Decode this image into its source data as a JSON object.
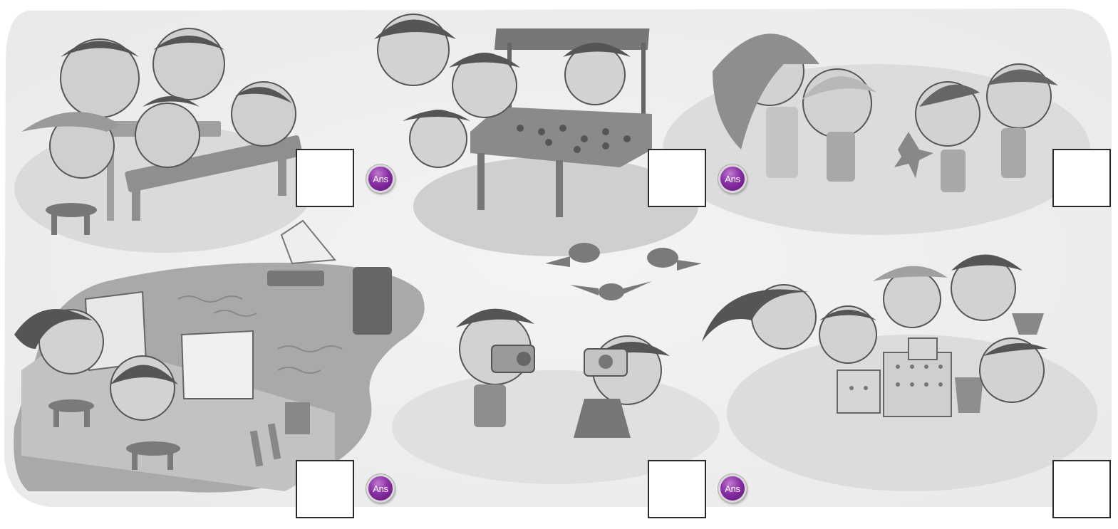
{
  "scenes": [
    {
      "name": "scene-picnic-table",
      "description_icon": "children-eating-at-bench-icon"
    },
    {
      "name": "scene-shell-stall",
      "description_icon": "children-at-shell-stall-icon"
    },
    {
      "name": "scene-starfish-beach",
      "description_icon": "children-with-starfish-icon"
    },
    {
      "name": "scene-painting-by-lake",
      "description_icon": "children-painting-icon"
    },
    {
      "name": "scene-taking-photos",
      "description_icon": "children-with-cameras-icon"
    },
    {
      "name": "scene-sandcastle",
      "description_icon": "children-building-sandcastle-icon"
    }
  ],
  "answer_boxes": [
    {
      "value": ""
    },
    {
      "value": ""
    },
    {
      "value": ""
    },
    {
      "value": ""
    },
    {
      "value": ""
    },
    {
      "value": ""
    }
  ],
  "ans_buttons": [
    {
      "label": "Ans"
    },
    {
      "label": "Ans"
    },
    {
      "label": "Ans"
    },
    {
      "label": "Ans"
    }
  ],
  "colors": {
    "illustration_gray": "#bdbdbd",
    "box_border": "#2a2a2a",
    "ans_purple": "#8a2fa6"
  }
}
